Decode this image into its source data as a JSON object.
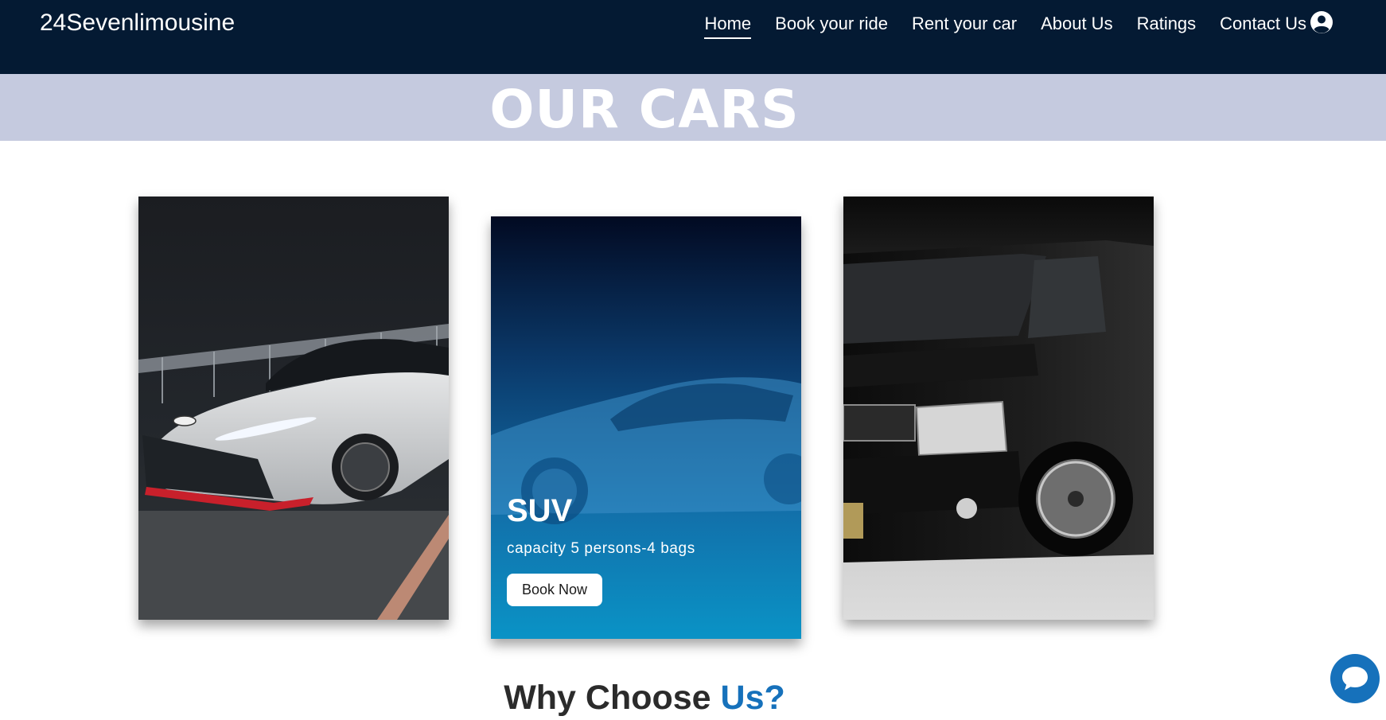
{
  "nav": {
    "brand": "24Sevenlimousine",
    "links": [
      {
        "label": "Home",
        "active": true
      },
      {
        "label": "Book your ride"
      },
      {
        "label": "Rent your car"
      },
      {
        "label": "About Us"
      },
      {
        "label": "Ratings"
      },
      {
        "label": "Contact Us"
      }
    ],
    "user_icon": "user-circle-icon"
  },
  "banner": {
    "title": "OUR CARS"
  },
  "cars": [
    {
      "image": "white-sedan-photo"
    },
    {
      "image": "blue-coupe-photo",
      "title": "SUV",
      "description": "capacity 5 persons-4 bags",
      "button": "Book Now"
    },
    {
      "image": "black-van-photo"
    }
  ],
  "section": {
    "heading_main": "Why Choose ",
    "heading_accent": "Us?"
  },
  "chat": {
    "icon": "chat-bubble-icon"
  },
  "colors": {
    "navbar": "#041a33",
    "banner": "#c5cadf",
    "accent": "#1671bb"
  }
}
